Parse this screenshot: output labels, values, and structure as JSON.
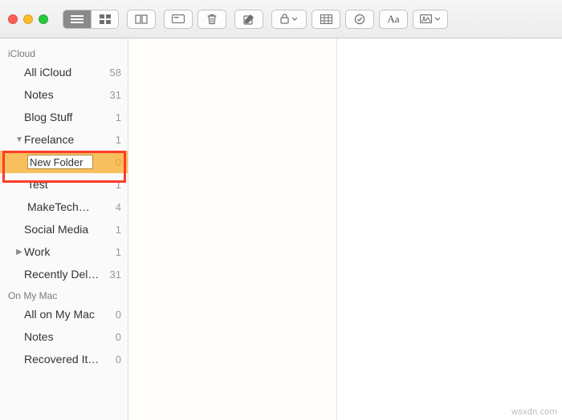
{
  "toolbar": {
    "icons": {
      "list": "list-view-icon",
      "grid": "grid-view-icon",
      "attach": "attachments-icon",
      "card": "card-icon",
      "trash": "trash-icon",
      "compose": "compose-icon",
      "lock": "lock-icon",
      "table": "table-icon",
      "checklist": "checklist-icon",
      "format": "format-icon",
      "media": "media-icon"
    },
    "format_label": "Aa"
  },
  "sidebar": {
    "sections": [
      {
        "name": "iCloud",
        "items": [
          {
            "label": "All iCloud",
            "count": 58,
            "indent": 0,
            "expand": null
          },
          {
            "label": "Notes",
            "count": 31,
            "indent": 0,
            "expand": null
          },
          {
            "label": "Blog Stuff",
            "count": 1,
            "indent": 0,
            "expand": null
          },
          {
            "label": "Freelance",
            "count": 1,
            "indent": 0,
            "expand": "open"
          },
          {
            "label": "New Folder",
            "count": 0,
            "indent": 1,
            "expand": null,
            "selected": true,
            "editing": true
          },
          {
            "label": "Test",
            "count": 1,
            "indent": 1,
            "expand": null
          },
          {
            "label": "MakeTech…",
            "count": 4,
            "indent": 1,
            "expand": null
          },
          {
            "label": "Social Media",
            "count": 1,
            "indent": 0,
            "expand": null
          },
          {
            "label": "Work",
            "count": 1,
            "indent": 0,
            "expand": "closed"
          },
          {
            "label": "Recently Del…",
            "count": 31,
            "indent": 0,
            "expand": null
          }
        ]
      },
      {
        "name": "On My Mac",
        "items": [
          {
            "label": "All on My Mac",
            "count": 0,
            "indent": 0,
            "expand": null
          },
          {
            "label": "Notes",
            "count": 0,
            "indent": 0,
            "expand": null
          },
          {
            "label": "Recovered It…",
            "count": 0,
            "indent": 0,
            "expand": null
          }
        ]
      }
    ]
  },
  "watermark": "wsxdn.com"
}
